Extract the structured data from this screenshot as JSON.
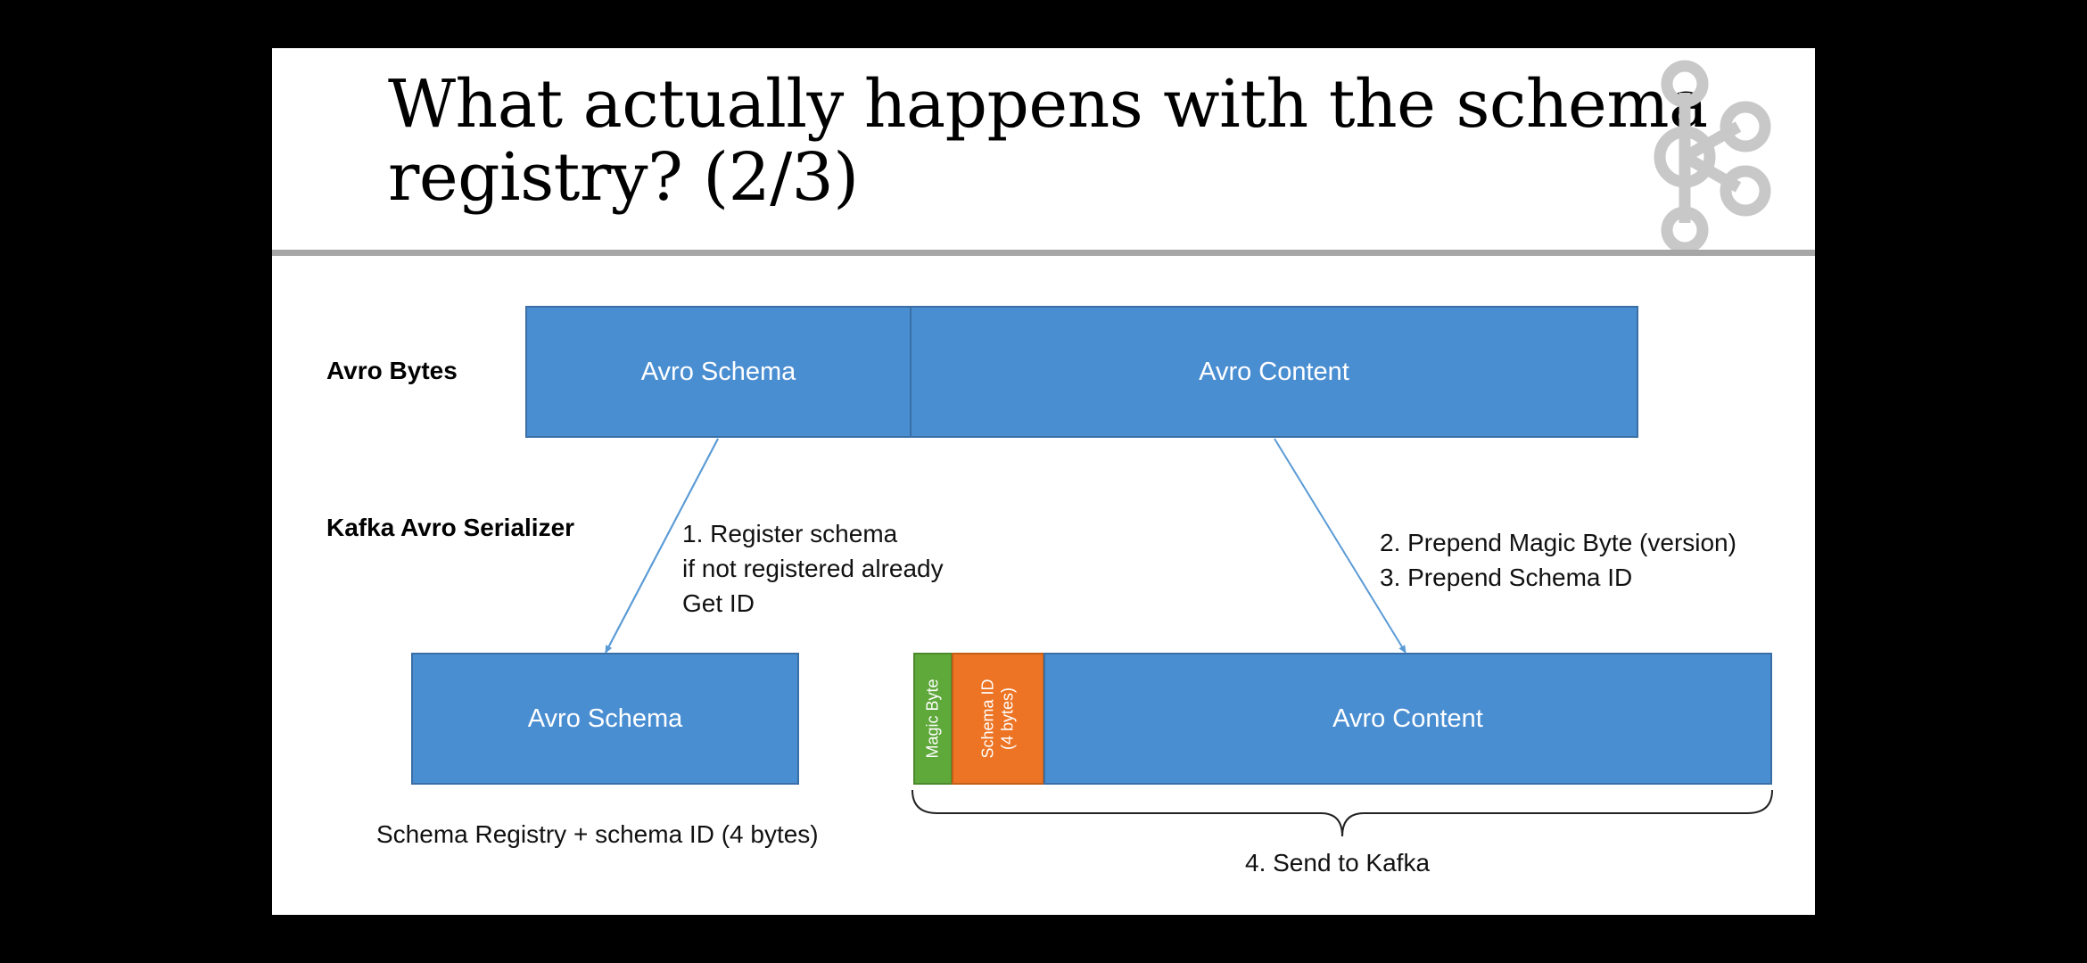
{
  "slide": {
    "title_lines": [
      "What actually happens with the schema",
      "registry? (2/3)"
    ]
  },
  "rows": {
    "avro_bytes_label": "Avro Bytes",
    "serializer_label": "Kafka Avro Serializer"
  },
  "top_boxes": {
    "schema": "Avro Schema",
    "content": "Avro Content"
  },
  "steps": {
    "register": [
      "1. Register schema",
      "if not registered already",
      "Get ID"
    ],
    "prepend": [
      "2. Prepend Magic Byte (version)",
      "3. Prepend Schema ID"
    ]
  },
  "bottom_left": {
    "box": "Avro Schema",
    "caption": "Schema Registry + schema ID (4 bytes)"
  },
  "bottom_right": {
    "magic_byte": "Magic Byte",
    "schema_id": [
      "Schema ID",
      "(4 bytes)"
    ],
    "content": "Avro Content",
    "caption": "4. Send to Kafka"
  },
  "colors": {
    "box_blue": "#4a8ed2",
    "magic_green": "#5fa83a",
    "schema_orange": "#ec7424",
    "rule_gray": "#a6a6a6",
    "logo_gray": "#c8c8c8",
    "arrow_blue": "#5b9bd5"
  },
  "icons": {
    "logo": "kafka-logo-icon"
  }
}
